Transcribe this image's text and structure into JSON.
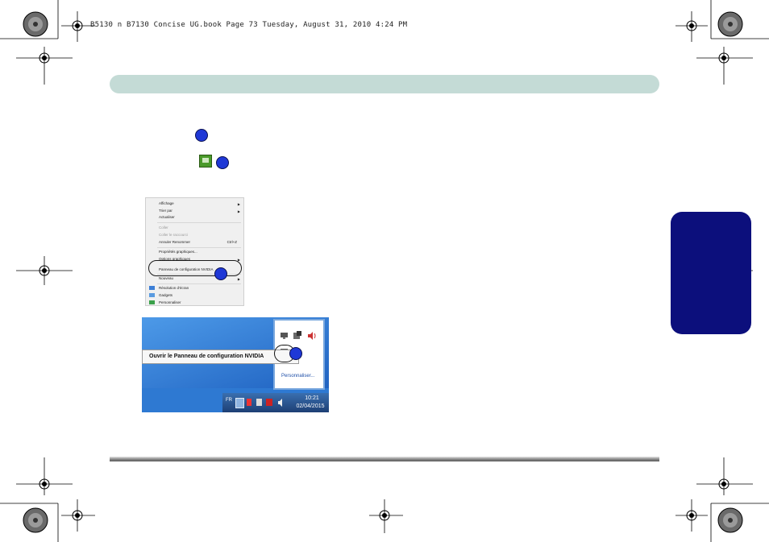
{
  "header": {
    "running_head": "B5130 n B7130 Concise UG.book  Page 73  Tuesday, August 31, 2010  4:24 PM"
  },
  "colors": {
    "header_bar": "#c4dbd6",
    "side_tab": "#0c0f7c",
    "step_marker": "#1f38d6"
  },
  "context_menu": {
    "items": [
      {
        "label": "Affichage",
        "submenu": true
      },
      {
        "label": "Trier par",
        "submenu": true
      },
      {
        "label": "Actualiser"
      },
      {
        "label": "Coller",
        "disabled": true
      },
      {
        "label": "Coller le raccourci",
        "disabled": true
      },
      {
        "label": "Annuler Renommer",
        "shortcut": "Ctrl+Z"
      },
      {
        "label": "Propriétés graphiques..."
      },
      {
        "label": "Options graphiques",
        "submenu": true
      },
      {
        "label": "Panneau de configuration NVIDIA"
      },
      {
        "label": "Nouveau",
        "submenu": true
      },
      {
        "label": "Résolution d'écran"
      },
      {
        "label": "Gadgets"
      },
      {
        "label": "Personnaliser"
      }
    ]
  },
  "tray": {
    "tooltip": "Ouvrir le Panneau de configuration NVIDIA",
    "customize": "Personnaliser...",
    "language": "FR",
    "time": "10:21",
    "date": "02/04/2015"
  },
  "icons": [
    "registration-crosshair-icon",
    "printer-rosette-icon",
    "nvidia-control-panel-icon",
    "volume-icon",
    "network-icon",
    "flag-icon"
  ]
}
